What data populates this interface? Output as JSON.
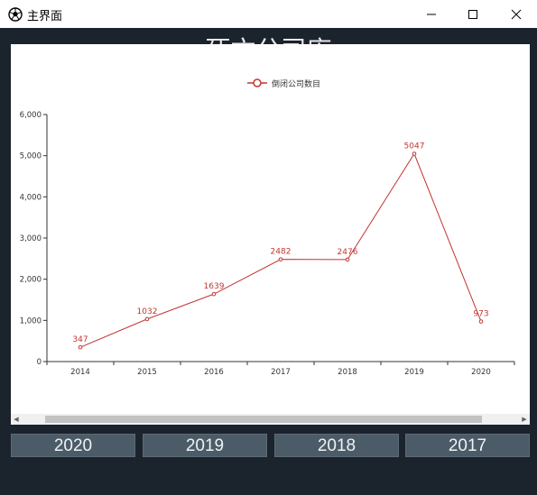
{
  "window": {
    "title": "主界面",
    "icon": "football-icon"
  },
  "app": {
    "heading": "死亡公司库"
  },
  "chart_data": {
    "type": "line",
    "categories": [
      "2014",
      "2015",
      "2016",
      "2017",
      "2018",
      "2019",
      "2020"
    ],
    "series": [
      {
        "name": "倒闭公司数目",
        "values": [
          347,
          1032,
          1639,
          2482,
          2476,
          5047,
          973
        ],
        "color": "#c23531"
      }
    ],
    "yticks": [
      "0",
      "1,000",
      "2,000",
      "3,000",
      "4,000",
      "5,000",
      "6,000"
    ],
    "ylim": [
      0,
      6000
    ],
    "legend": "top-center",
    "grid": false
  },
  "year_buttons": [
    {
      "label": "2020"
    },
    {
      "label": "2019"
    },
    {
      "label": "2018"
    },
    {
      "label": "2017"
    }
  ]
}
